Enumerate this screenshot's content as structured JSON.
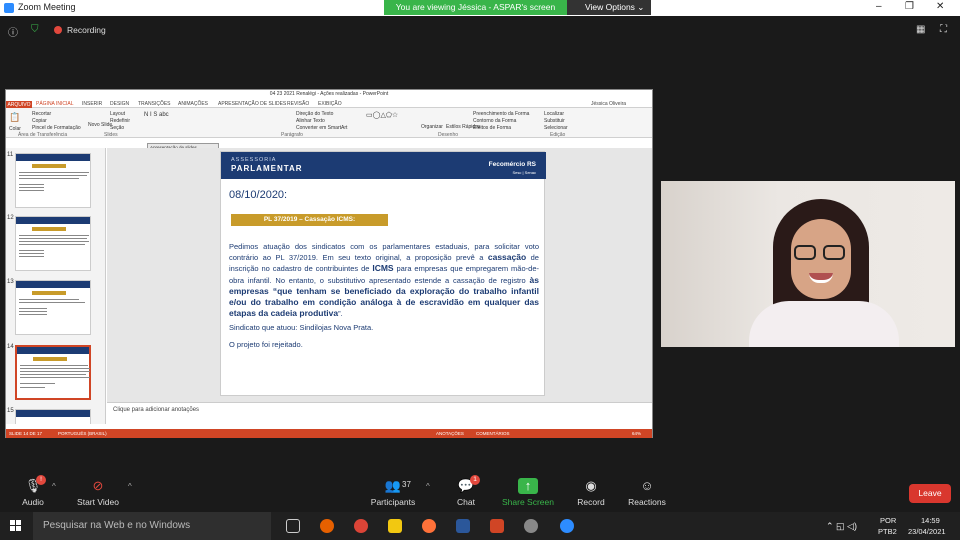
{
  "zoom": {
    "title": "Zoom Meeting",
    "banner": "You are viewing Jéssica - ASPAR's screen",
    "view_options": "View Options",
    "recording": "Recording",
    "controls": {
      "audio": "Audio",
      "start_video": "Start Video",
      "participants": "Participants",
      "participants_count": "37",
      "chat": "Chat",
      "chat_badge": "1",
      "share": "Share Screen",
      "record": "Record",
      "reactions": "Reactions",
      "leave": "Leave"
    },
    "accent_green": "#39b54a",
    "leave_color": "#d9372e"
  },
  "ppt": {
    "window_title": "04 23 2021 Renalégi - Ações realizadas - PowerPoint",
    "tabs": [
      "ARQUIVO",
      "PÁGINA INICIAL",
      "INSERIR",
      "DESIGN",
      "TRANSIÇÕES",
      "ANIMAÇÕES",
      "APRESENTAÇÃO DE SLIDES",
      "REVISÃO",
      "EXIBIÇÃO"
    ],
    "user": "Jéssica Oliveira",
    "ribbon": {
      "colar": "Colar",
      "recortar": "Recortar",
      "copiar": "Copiar",
      "pincel": "Pincel de Formatação",
      "area": "Área de Transferência",
      "novo_slide": "Novo Slide",
      "layout": "Layout",
      "redefinir": "Redefinir",
      "secao": "Seção",
      "slides": "Slides",
      "direcao": "Direção do Texto",
      "alinhar": "Alinhar Texto",
      "smartart": "Converter em SmartArt",
      "paragrafo": "Parágrafo",
      "organizar": "Organizar",
      "estilos": "Estilos Rápidos",
      "preenchimento": "Preenchimento da Forma",
      "contorno": "Contorno da Forma",
      "efeitos": "Efeitos de Forma",
      "desenho": "Desenho",
      "localizar": "Localizar",
      "substituir": "Substituir",
      "selecionar": "Selecionar",
      "edicao": "Edição"
    },
    "tooltip": {
      "line1": "Apresentação de slides",
      "line2": "Reiniciar apresentação de slides"
    },
    "thumbs": [
      "11",
      "12",
      "13",
      "14",
      "15"
    ],
    "notes": "Clique para adicionar anotações",
    "status": {
      "slide": "SLIDE 14 DE 17",
      "lang": "PORTUGUÊS (BRASIL)",
      "anotacoes": "ANOTAÇÕES",
      "comentarios": "COMENTÁRIOS",
      "zoom": "64%"
    },
    "accent": "#d04525"
  },
  "slide": {
    "header_small": "ASSESSORIA",
    "header_big": "PARLAMENTAR",
    "brand": "Fecomércio RS",
    "brand_sub": "Sesc | Senac",
    "date": "08/10/2020:",
    "pl": "PL 37/2019 – Cassação ICMS:",
    "p1": "Pedimos atuação dos sindicatos com os parlamentares estaduais, para solicitar voto contrário ao PL 37/2019. Em seu texto original, a proposição prevê a",
    "p1_b1": "cassação",
    "p1_c": "de inscrição no cadastro de contribuintes de",
    "p1_b2": "ICMS",
    "p1_d": "para empresas que empregarem mão-de-obra infantil. No entanto, o substitutivo apresentado estende a cassação de registro",
    "p1_b3": "às empresas “que tenham se beneficiado da exploração do trabalho infantil e/ou do trabalho em condição análoga à de escravidão em qualquer das etapas da cadeia produtiva",
    "p1_e": "”.",
    "sindicato": "Sindicato que atuou: Sindilojas Nova Prata.",
    "projeto": "O projeto foi rejeitado.",
    "navy": "#1c3b73",
    "gold": "#c89b2a"
  },
  "taskbar": {
    "search_placeholder": "Pesquisar na Web e no Windows",
    "lang1": "POR",
    "lang2": "PTB2",
    "time": "14:59",
    "date": "23/04/2021"
  }
}
